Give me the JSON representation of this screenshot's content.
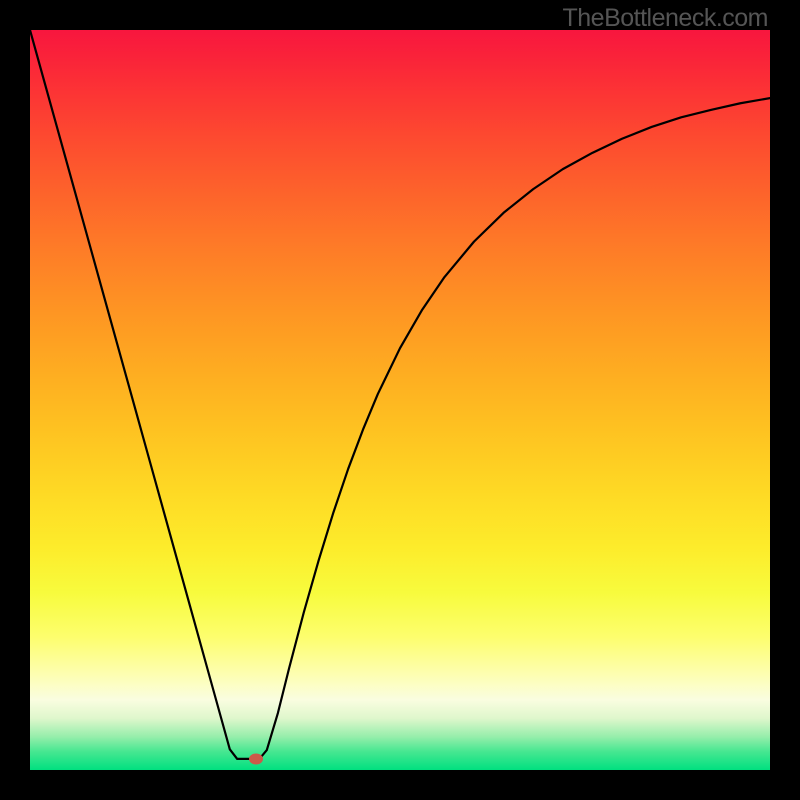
{
  "watermark": {
    "text": "TheBottleneck.com"
  },
  "gradient": {
    "stops": [
      {
        "offset": 0.0,
        "color": "#f8163e"
      },
      {
        "offset": 0.06,
        "color": "#fb2b37"
      },
      {
        "offset": 0.14,
        "color": "#fd4830"
      },
      {
        "offset": 0.22,
        "color": "#fd632b"
      },
      {
        "offset": 0.3,
        "color": "#fe7d27"
      },
      {
        "offset": 0.38,
        "color": "#fe9523"
      },
      {
        "offset": 0.46,
        "color": "#feac21"
      },
      {
        "offset": 0.54,
        "color": "#fec221"
      },
      {
        "offset": 0.62,
        "color": "#fed824"
      },
      {
        "offset": 0.7,
        "color": "#fdec2b"
      },
      {
        "offset": 0.76,
        "color": "#f7fb3d"
      },
      {
        "offset": 0.82,
        "color": "#fdfe6d"
      },
      {
        "offset": 0.87,
        "color": "#fdfeb0"
      },
      {
        "offset": 0.905,
        "color": "#fafde0"
      },
      {
        "offset": 0.93,
        "color": "#dff7cc"
      },
      {
        "offset": 0.955,
        "color": "#96eeab"
      },
      {
        "offset": 0.975,
        "color": "#47e791"
      },
      {
        "offset": 1.0,
        "color": "#00e080"
      }
    ]
  },
  "marker": {
    "x_frac": 0.305,
    "y_frac": 0.985
  },
  "chart_data": {
    "type": "line",
    "title": "",
    "xlabel": "",
    "ylabel": "",
    "xlim": [
      0,
      1
    ],
    "ylim": [
      0,
      1
    ],
    "series": [
      {
        "name": "curve",
        "x": [
          0.0,
          0.02,
          0.04,
          0.06,
          0.08,
          0.1,
          0.12,
          0.14,
          0.16,
          0.18,
          0.2,
          0.22,
          0.24,
          0.26,
          0.27,
          0.28,
          0.29,
          0.3,
          0.31,
          0.32,
          0.335,
          0.35,
          0.37,
          0.39,
          0.41,
          0.43,
          0.45,
          0.47,
          0.5,
          0.53,
          0.56,
          0.6,
          0.64,
          0.68,
          0.72,
          0.76,
          0.8,
          0.84,
          0.88,
          0.92,
          0.96,
          1.0
        ],
        "y": [
          1.0,
          0.928,
          0.856,
          0.784,
          0.712,
          0.64,
          0.568,
          0.496,
          0.424,
          0.352,
          0.28,
          0.208,
          0.136,
          0.064,
          0.028,
          0.015,
          0.015,
          0.015,
          0.015,
          0.027,
          0.077,
          0.137,
          0.213,
          0.283,
          0.348,
          0.407,
          0.46,
          0.508,
          0.57,
          0.622,
          0.666,
          0.714,
          0.753,
          0.785,
          0.812,
          0.834,
          0.853,
          0.869,
          0.882,
          0.892,
          0.901,
          0.908
        ]
      }
    ],
    "annotations": []
  }
}
